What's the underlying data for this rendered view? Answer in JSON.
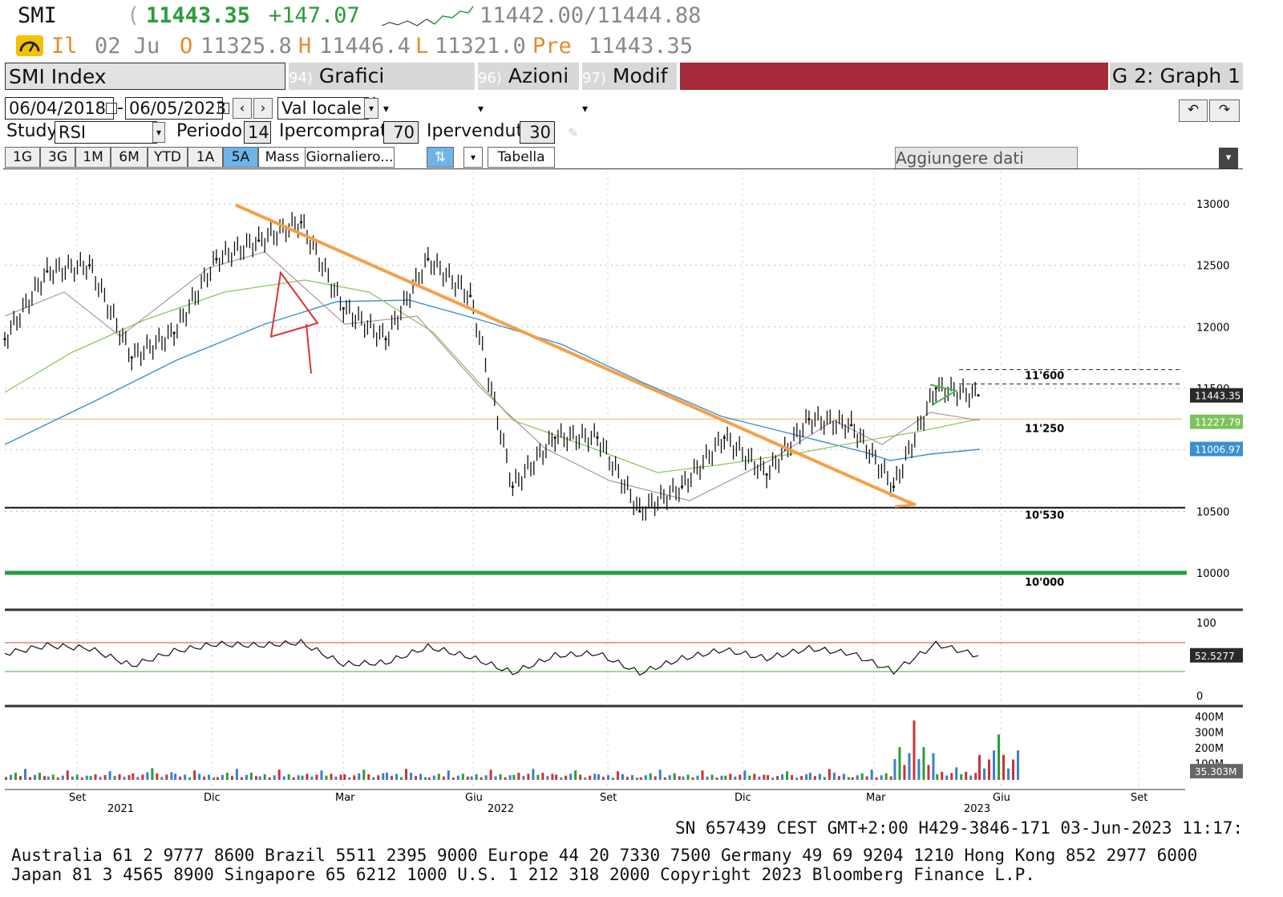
{
  "quote": {
    "ticker": "SMI",
    "paren": "(",
    "last": "11443.35",
    "change": "+147.07",
    "bid_ask": "11442.00/11444.88",
    "icon": "gauge-icon",
    "line2_prefix": "Il",
    "date": "02 Ju",
    "open_label": "O",
    "open": "11325.8",
    "high_label": "H",
    "high": "11446.4",
    "low_label": "L",
    "low": "11321.0",
    "pre_label": "Pre",
    "pre": "11443.35"
  },
  "menu": {
    "security": "SMI Index",
    "suggested_num": "94)",
    "suggested": "Grafici suggeriti",
    "actions_num": "96)",
    "actions": "Azioni",
    "modify_num": "97)",
    "modify": "Modif",
    "graph": "G 2: Graph 1",
    "chevron": "▾"
  },
  "controls": {
    "date_from": "06/04/2018",
    "date_sep": "-",
    "date_to": "06/05/2023",
    "currency": "Val locale",
    "study_label": "Study",
    "study": "RSI",
    "period_label": "Periodo",
    "period": "14",
    "overbought_label": "Ipercomprato",
    "overbought": "70",
    "oversold_label": "Ipervenduto",
    "oversold": "30",
    "add_data": "Aggiungere dati",
    "ranges": [
      "1G",
      "3G",
      "1M",
      "6M",
      "YTD",
      "1A",
      "5A",
      "Mass"
    ],
    "active_range": "5A",
    "frequency": "Giornaliero...",
    "table": "Tabella"
  },
  "colors": {
    "green": "#2a9d3a",
    "orange": "#f5a04a",
    "red_bar": "#a52a3a",
    "ma_blue": "#3a8fd0",
    "ma_green": "#8cc858",
    "ma_purple": "#a98aa8",
    "sel_blue": "#6fb4e8",
    "tag_dark": "#2a2a2a"
  },
  "chart_data": {
    "type": "line",
    "price_ticks": [
      "13000",
      "12500",
      "12000",
      "11500",
      "11000",
      "10500",
      "10000"
    ],
    "rsi_ticks": [
      "100",
      "0"
    ],
    "volume_ticks": [
      "400M",
      "300M",
      "200M",
      "100M"
    ],
    "month_labels": [
      "Set",
      "Dic",
      "Mar",
      "Giu",
      "Set",
      "Dic",
      "Mar",
      "Giu",
      "Set"
    ],
    "year_labels": [
      "2021",
      "2022",
      "2023"
    ],
    "levels": [
      {
        "label": "11'600",
        "value": 11600
      },
      {
        "label": "11'250",
        "value": 11250
      },
      {
        "label": "10'530",
        "value": 10530
      },
      {
        "label": "10'000",
        "value": 10000
      }
    ],
    "last_tags": {
      "price": "11443.35",
      "ma_green": "11227.79",
      "ma_blue": "11006.97",
      "rsi": "52.5277",
      "volume": "35.303M"
    },
    "x": [
      "2021-06",
      "2021-07",
      "2021-08",
      "2021-09",
      "2021-10",
      "2021-11",
      "2021-12",
      "2022-01",
      "2022-02",
      "2022-03",
      "2022-04",
      "2022-05",
      "2022-06",
      "2022-07",
      "2022-08",
      "2022-09",
      "2022-10",
      "2022-11",
      "2022-12",
      "2023-01",
      "2023-02",
      "2023-03",
      "2023-04",
      "2023-05"
    ],
    "series": [
      {
        "values": [
          11900,
          12450,
          12500,
          11750,
          11950,
          12550,
          12700,
          12850,
          12150,
          11900,
          12550,
          12250,
          10700,
          11100,
          11100,
          10500,
          10700,
          11100,
          10800,
          11250,
          11200,
          10700,
          11500,
          11443
        ]
      }
    ],
    "rsi": [
      55,
      66,
      62,
      38,
      58,
      68,
      66,
      70,
      40,
      42,
      64,
      50,
      28,
      52,
      55,
      28,
      48,
      60,
      48,
      62,
      55,
      30,
      68,
      52
    ],
    "volume": [
      70,
      60,
      55,
      75,
      60,
      70,
      65,
      60,
      65,
      70,
      60,
      65,
      70,
      60,
      55,
      65,
      60,
      60,
      55,
      70,
      65,
      380,
      80,
      290
    ],
    "ylim": [
      10000,
      13000
    ]
  },
  "footer": {
    "sn": "SN 657439 CEST GMT+2:00 H429-3846-171 03-Jun-2023 11:17:",
    "line1": "Australia 61 2 9777 8600 Brazil 5511 2395 9000 Europe 44 20 7330 7500 Germany 49 69 9204 1210 Hong Kong 852 2977 6000",
    "line2": "Japan 81 3 4565 8900       Singapore 65 6212 1000       U.S. 1 212 318 2000        Copyright 2023 Bloomberg Finance L.P."
  }
}
